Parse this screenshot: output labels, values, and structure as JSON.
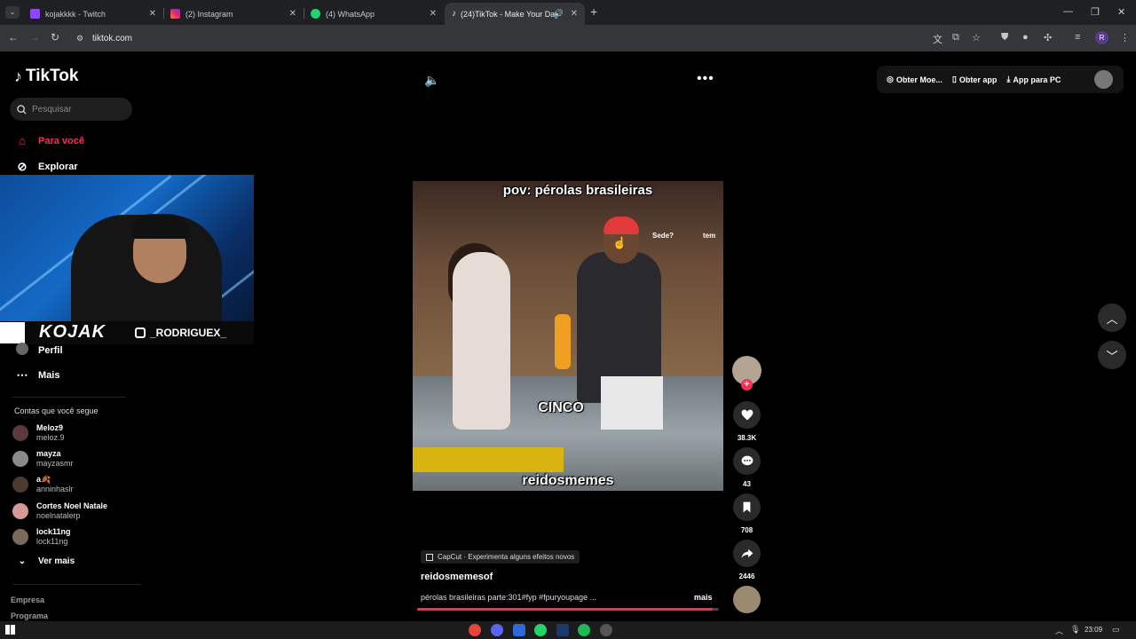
{
  "browser": {
    "tabs": [
      {
        "title": "kojakkkk - Twitch",
        "favicon_color": "#9146ff",
        "active": false
      },
      {
        "title": "(2) Instagram",
        "favicon_color": "#e1306c",
        "active": false
      },
      {
        "title": "(4) WhatsApp",
        "favicon_color": "#25d366",
        "active": false
      },
      {
        "title": "(24)TikTok - Make Your Day",
        "favicon_color": "#ffffff",
        "active": true
      }
    ],
    "url": "tiktok.com",
    "profile_initial": "R"
  },
  "tiktok": {
    "logo": "TikTok",
    "search_placeholder": "Pesquisar",
    "nav": {
      "for_you": "Para você",
      "explore": "Explorar",
      "profile": "Perfil",
      "more": "Mais"
    },
    "stream_overlay": {
      "streamer_tag": "KOJAK",
      "instagram_handle": "_RODRIGUEX_"
    },
    "following": {
      "heading": "Contas que você segue",
      "accounts": [
        {
          "name": "Meloz9",
          "handle": "meloz.9",
          "color": "#5a3a3a"
        },
        {
          "name": "mayza",
          "handle": "mayzasmr",
          "color": "#8a8a8a"
        },
        {
          "name": "a🍂",
          "handle": "anninhaslr",
          "color": "#4a3a30"
        },
        {
          "name": "Cortes Noel Natale",
          "handle": "noelnatalerp",
          "color": "#d89898"
        },
        {
          "name": "lock11ng",
          "handle": "lock11ng",
          "color": "#7a6a5a"
        }
      ],
      "see_more": "Ver mais"
    },
    "footer": [
      "Empresa",
      "Programa"
    ],
    "top_right": {
      "coins": "Obter Moe...",
      "get_app": "Obter app",
      "pc_app": "App para PC"
    },
    "video": {
      "caption_top": "pov: pérolas brasileiras",
      "caption_mid": "CINCO",
      "caption_bottom": "reidosmemes",
      "sign_left": "Sede?",
      "sign_right": "tem",
      "capcut_badge": "CapCut · Experimenta alguns efeitos novos",
      "author": "reidosmemesof",
      "description": "pérolas brasileiras parte:301#fyp #fpuryoupage ...",
      "more_label": "mais",
      "progress": 0.98
    },
    "actions": {
      "likes": "38.3K",
      "comments": "43",
      "saves": "708",
      "shares": "2446"
    },
    "accent": "#fe2c55"
  },
  "taskbar": {
    "clock": "23:09"
  }
}
